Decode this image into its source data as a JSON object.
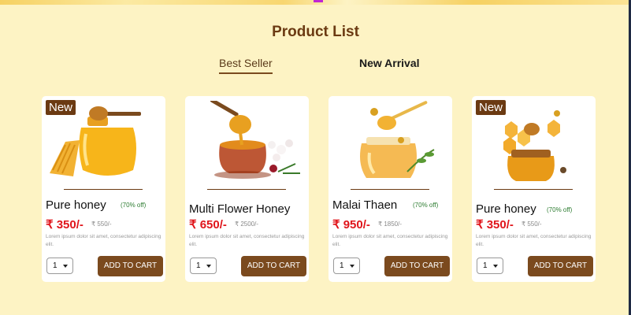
{
  "page": {
    "title": "Product List"
  },
  "tabs": [
    {
      "label": "Best Seller",
      "active": true
    },
    {
      "label": "New Arrival",
      "active": false
    }
  ],
  "products": [
    {
      "badge": "New",
      "name": "Pure honey",
      "discount": "(70% off)",
      "price": "₹ 350/-",
      "mrp": "₹ 550/-",
      "description": "Lorem ipsum dolor sit amet, consectetur adipiscing elit.",
      "qty": "1",
      "cart_label": "ADD TO CART",
      "image": "honey-jar-with-comb"
    },
    {
      "badge": "",
      "name": "Multi Flower Honey",
      "discount": "",
      "price": "₹ 650/-",
      "mrp": "₹ 2500/-",
      "description": "Lorem ipsum dolor sit amet, consectetur adipiscing elit.",
      "qty": "1",
      "cart_label": "ADD TO CART",
      "image": "honey-bowl-with-flowers"
    },
    {
      "badge": "",
      "name": "Malai Thaen",
      "discount": "(70% off)",
      "price": "₹ 950/-",
      "mrp": "₹ 1850/-",
      "description": "Lorem ipsum dolor sit amet, consectetur adipiscing elit.",
      "qty": "1",
      "cart_label": "ADD TO CART",
      "image": "honey-jar-with-bees"
    },
    {
      "badge": "New",
      "name": "Pure honey",
      "discount": "(70% off)",
      "price": "₹ 350/-",
      "mrp": "₹ 550/-",
      "description": "Lorem ipsum dolor sit amet, consectetur adipiscing elit.",
      "qty": "1",
      "cart_label": "ADD TO CART",
      "image": "honey-jar-honeycomb-bees"
    }
  ],
  "colors": {
    "background": "#fdf3c4",
    "brand": "#7b4a1e",
    "price": "#e0151b",
    "discount": "#2e7d32"
  }
}
